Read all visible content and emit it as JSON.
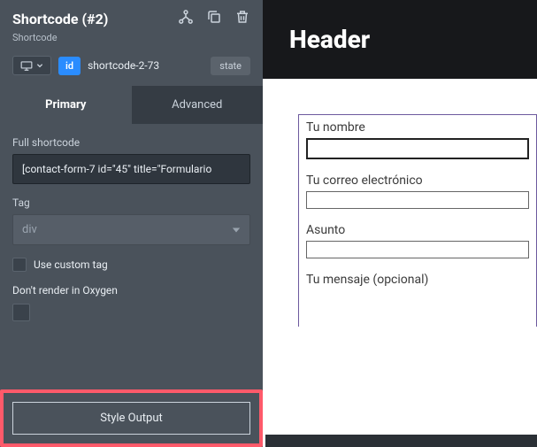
{
  "sidebar": {
    "title": "Shortcode (#2)",
    "subtitle": "Shortcode",
    "id_badge": "id",
    "id_text": "shortcode-2-73",
    "state_label": "state",
    "tabs": {
      "primary": "Primary",
      "advanced": "Advanced"
    },
    "full_shortcode_label": "Full shortcode",
    "full_shortcode_value": "[contact-form-7 id=\"45\" title=\"Formulario",
    "tag_label": "Tag",
    "tag_value": "div",
    "use_custom_tag_label": "Use custom tag",
    "dont_render_label": "Don't render in Oxygen",
    "style_output_label": "Style Output"
  },
  "canvas": {
    "header_title": "Header",
    "form": {
      "name_label": "Tu nombre",
      "email_label": "Tu correo electrónico",
      "subject_label": "Asunto",
      "message_label": "Tu mensaje (opcional)"
    }
  }
}
